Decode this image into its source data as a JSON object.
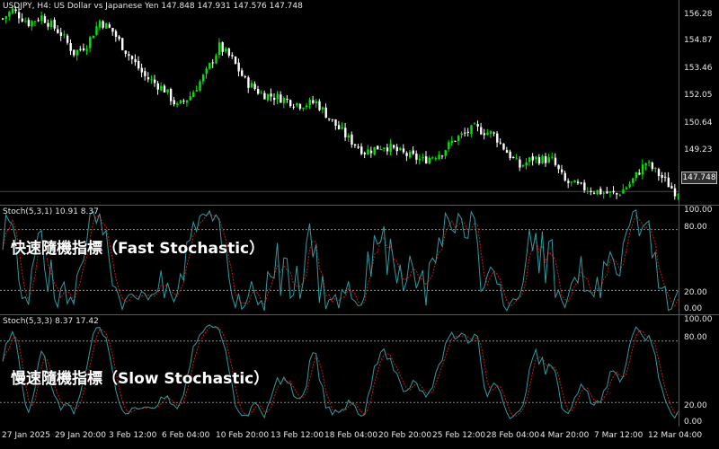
{
  "price_pane": {
    "header": "USDJPY, H4:  US Dollar vs Japanese Yen  147.848 147.931 147.576 147.748",
    "current_price": "147.748",
    "axis_labels": [
      "156.28",
      "154.87",
      "153.46",
      "152.05",
      "150.64",
      "149.23"
    ]
  },
  "fast_pane": {
    "header": "Stoch(5,3,1) 10.91 8.37",
    "caption": "快速隨機指標（Fast Stochastic）",
    "axis_labels": [
      "100.00",
      "80.00",
      "20.00",
      "0.00"
    ]
  },
  "slow_pane": {
    "header": "Stoch(5,3,3) 8.37 17.42",
    "caption": "慢速隨機指標（Slow Stochastic）",
    "axis_labels": [
      "100.00",
      "80.00",
      "20.00",
      "0.00"
    ]
  },
  "time_axis": [
    "27 Jan 2025",
    "29 Jan 20:00",
    "3 Feb 12:00",
    "6 Feb 04:00",
    "10 Feb 20:00",
    "13 Feb 12:00",
    "18 Feb 04:00",
    "20 Feb 20:00",
    "25 Feb 12:00",
    "28 Feb 04:00",
    "4 Mar 20:00",
    "7 Mar 12:00",
    "12 Mar 04:00"
  ],
  "colors": {
    "bull_candle": "#00e600",
    "bear_candle": "#ffffff",
    "stoch_main": "#2f9aa0",
    "stoch_signal": "#d01818",
    "grid": "#8a8a8a"
  },
  "chart_data": {
    "type": "candlestick",
    "symbol": "USDJPY",
    "timeframe": "H4",
    "price_range": [
      147.3,
      156.5
    ],
    "close_path": [
      [
        0,
        155.8
      ],
      [
        3,
        156.2
      ],
      [
        8,
        155.6
      ],
      [
        12,
        155.9
      ],
      [
        18,
        155.1
      ],
      [
        22,
        154.2
      ],
      [
        26,
        154.6
      ],
      [
        30,
        155.7
      ],
      [
        34,
        155.2
      ],
      [
        38,
        154.3
      ],
      [
        44,
        153.1
      ],
      [
        50,
        152.5
      ],
      [
        54,
        151.7
      ],
      [
        58,
        152.2
      ],
      [
        63,
        153.3
      ],
      [
        67,
        154.5
      ],
      [
        71,
        153.9
      ],
      [
        75,
        152.9
      ],
      [
        80,
        152.3
      ],
      [
        86,
        152.1
      ],
      [
        92,
        151.8
      ],
      [
        97,
        151.9
      ],
      [
        102,
        151.0
      ],
      [
        107,
        150.2
      ],
      [
        112,
        149.6
      ],
      [
        118,
        149.9
      ],
      [
        124,
        149.5
      ],
      [
        130,
        149.2
      ],
      [
        136,
        149.6
      ],
      [
        140,
        150.2
      ],
      [
        146,
        150.7
      ],
      [
        152,
        150.4
      ],
      [
        156,
        149.6
      ],
      [
        160,
        148.9
      ],
      [
        164,
        149.3
      ],
      [
        170,
        149.2
      ],
      [
        174,
        148.2
      ],
      [
        180,
        147.9
      ],
      [
        186,
        147.7
      ],
      [
        190,
        147.6
      ],
      [
        194,
        148.1
      ],
      [
        199,
        149.1
      ],
      [
        204,
        148.4
      ],
      [
        208,
        147.75
      ]
    ],
    "stoch_levels": [
      0,
      20,
      80,
      100
    ]
  }
}
